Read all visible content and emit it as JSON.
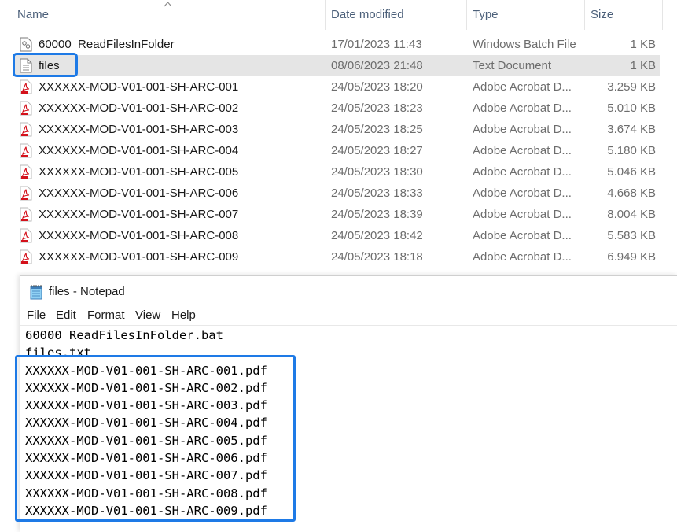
{
  "explorer": {
    "columns": {
      "name": "Name",
      "date": "Date modified",
      "type": "Type",
      "size": "Size"
    },
    "files": [
      {
        "name": "60000_ReadFilesInFolder",
        "date": "17/01/2023 11:43",
        "type": "Windows Batch File",
        "size": "1 KB",
        "icon": "batch-file-icon"
      },
      {
        "name": "files",
        "date": "08/06/2023 21:48",
        "type": "Text Document",
        "size": "1 KB",
        "icon": "text-file-icon"
      },
      {
        "name": "XXXXXX-MOD-V01-001-SH-ARC-001",
        "date": "24/05/2023 18:20",
        "type": "Adobe Acrobat D...",
        "size": "3.259 KB",
        "icon": "pdf-file-icon"
      },
      {
        "name": "XXXXXX-MOD-V01-001-SH-ARC-002",
        "date": "24/05/2023 18:23",
        "type": "Adobe Acrobat D...",
        "size": "5.010 KB",
        "icon": "pdf-file-icon"
      },
      {
        "name": "XXXXXX-MOD-V01-001-SH-ARC-003",
        "date": "24/05/2023 18:25",
        "type": "Adobe Acrobat D...",
        "size": "3.674 KB",
        "icon": "pdf-file-icon"
      },
      {
        "name": "XXXXXX-MOD-V01-001-SH-ARC-004",
        "date": "24/05/2023 18:27",
        "type": "Adobe Acrobat D...",
        "size": "5.180 KB",
        "icon": "pdf-file-icon"
      },
      {
        "name": "XXXXXX-MOD-V01-001-SH-ARC-005",
        "date": "24/05/2023 18:30",
        "type": "Adobe Acrobat D...",
        "size": "5.046 KB",
        "icon": "pdf-file-icon"
      },
      {
        "name": "XXXXXX-MOD-V01-001-SH-ARC-006",
        "date": "24/05/2023 18:33",
        "type": "Adobe Acrobat D...",
        "size": "4.668 KB",
        "icon": "pdf-file-icon"
      },
      {
        "name": "XXXXXX-MOD-V01-001-SH-ARC-007",
        "date": "24/05/2023 18:39",
        "type": "Adobe Acrobat D...",
        "size": "8.004 KB",
        "icon": "pdf-file-icon"
      },
      {
        "name": "XXXXXX-MOD-V01-001-SH-ARC-008",
        "date": "24/05/2023 18:42",
        "type": "Adobe Acrobat D...",
        "size": "5.583 KB",
        "icon": "pdf-file-icon"
      },
      {
        "name": "XXXXXX-MOD-V01-001-SH-ARC-009",
        "date": "24/05/2023 18:18",
        "type": "Adobe Acrobat D...",
        "size": "6.949 KB",
        "icon": "pdf-file-icon"
      }
    ]
  },
  "notepad": {
    "title": "files - Notepad",
    "menu": {
      "file": "File",
      "edit": "Edit",
      "format": "Format",
      "view": "View",
      "help": "Help"
    },
    "lines": [
      "60000_ReadFilesInFolder.bat",
      "files.txt",
      "XXXXXX-MOD-V01-001-SH-ARC-001.pdf",
      "XXXXXX-MOD-V01-001-SH-ARC-002.pdf",
      "XXXXXX-MOD-V01-001-SH-ARC-003.pdf",
      "XXXXXX-MOD-V01-001-SH-ARC-004.pdf",
      "XXXXXX-MOD-V01-001-SH-ARC-005.pdf",
      "XXXXXX-MOD-V01-001-SH-ARC-006.pdf",
      "XXXXXX-MOD-V01-001-SH-ARC-007.pdf",
      "XXXXXX-MOD-V01-001-SH-ARC-008.pdf",
      "XXXXXX-MOD-V01-001-SH-ARC-009.pdf"
    ]
  },
  "colors": {
    "highlight": "#1e7ae6",
    "selected_row": "#e5e5e5",
    "pdf_red": "#d4111b"
  }
}
